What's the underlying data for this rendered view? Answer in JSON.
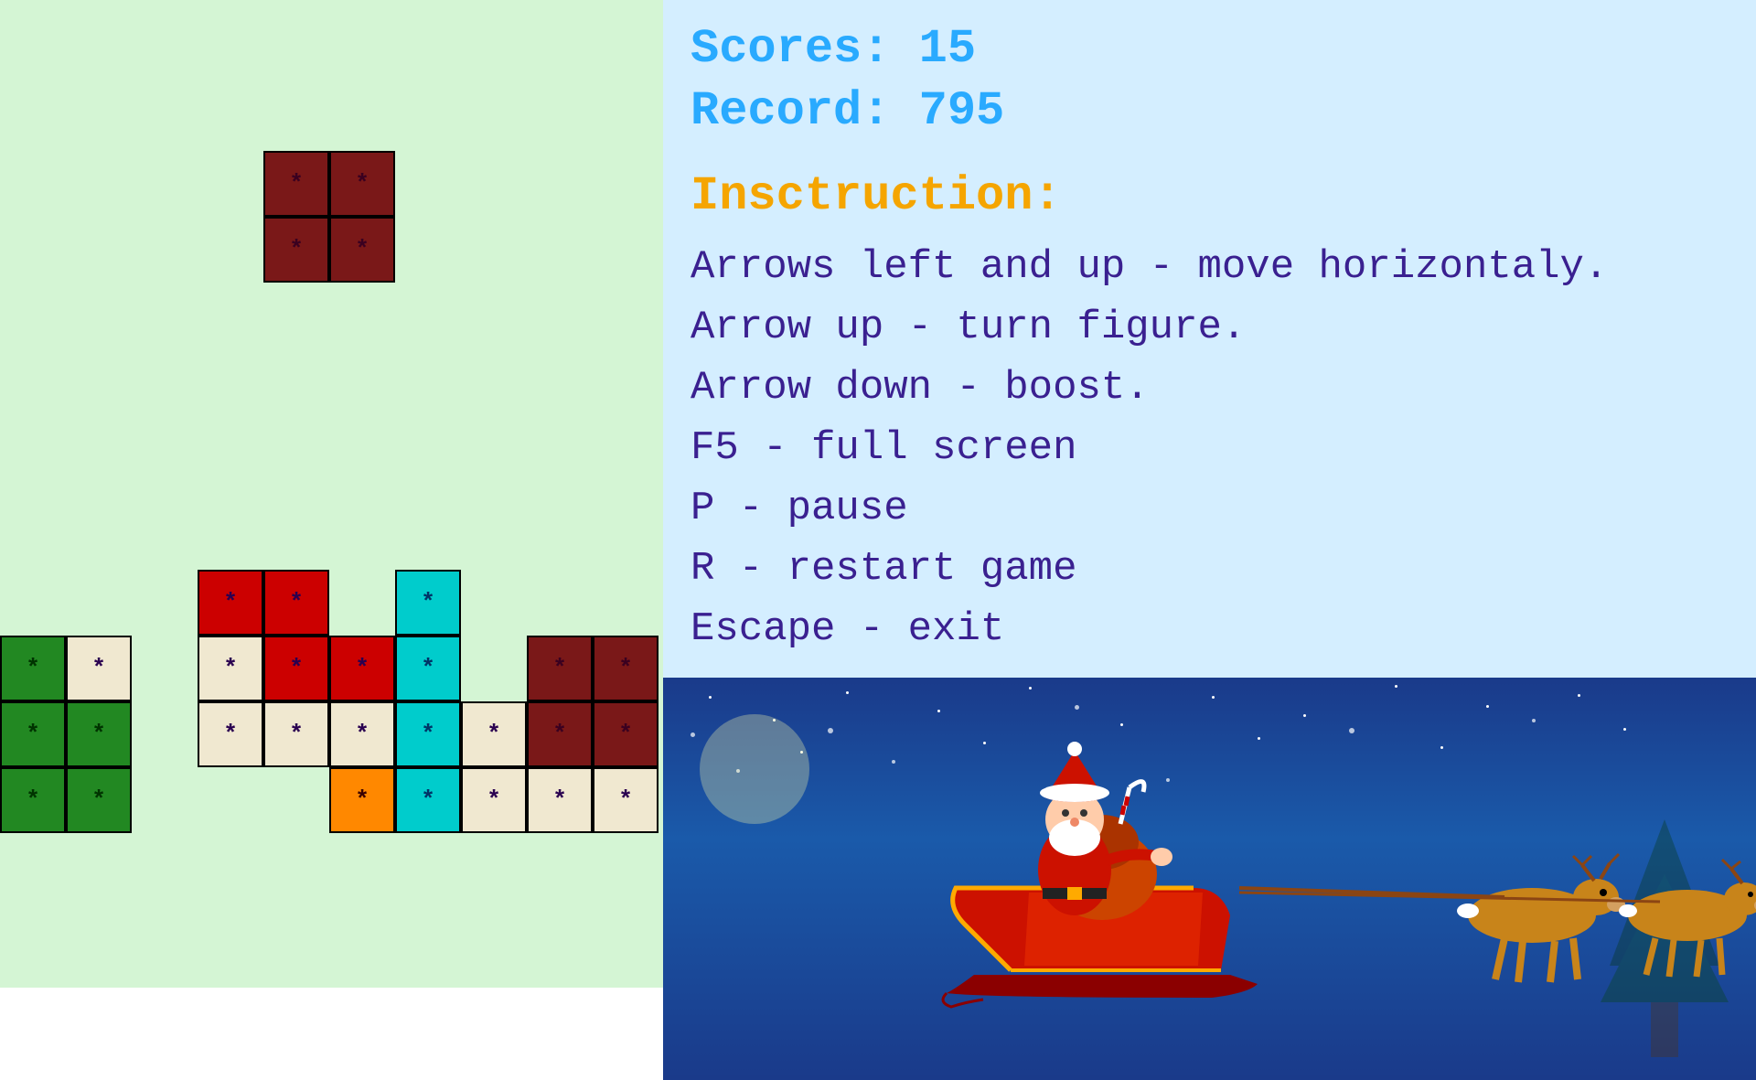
{
  "scores": {
    "label": "Scores: 15",
    "record_label": "Record: 795"
  },
  "instruction": {
    "heading": "Insctruction:",
    "lines": [
      "Arrows left and up - move horizontaly.",
      "Arrow up - turn figure.",
      "Arrow down - boost.",
      "F5 - full screen",
      "P - pause",
      "R - restart game",
      "Escape - exit"
    ]
  },
  "cells": {
    "star_char": "*"
  }
}
